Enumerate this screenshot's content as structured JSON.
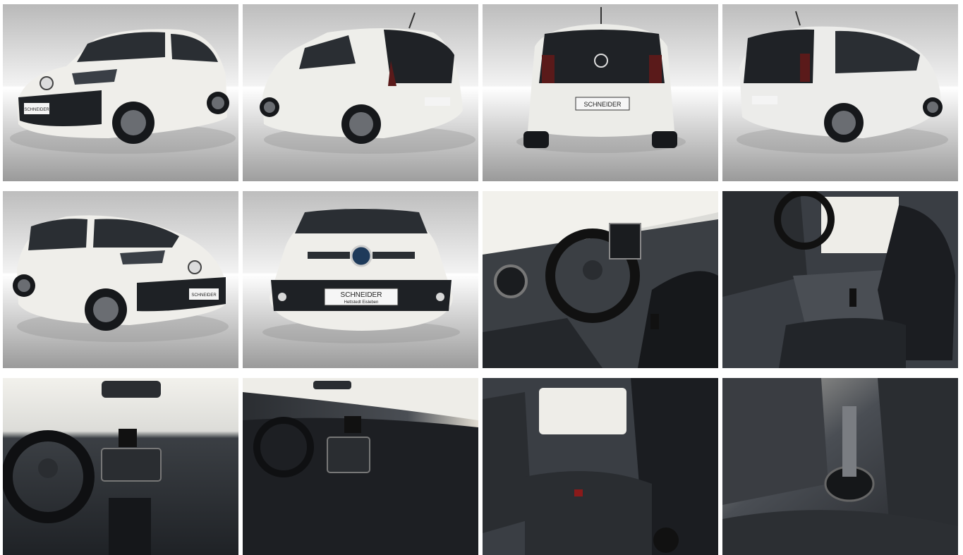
{
  "gallery": {
    "photos": [
      {
        "view": "front-left-exterior",
        "plate_text": "SCHNEIDER",
        "plate_subtext": ""
      },
      {
        "view": "rear-left-exterior",
        "plate_text": "",
        "plate_subtext": ""
      },
      {
        "view": "rear-exterior",
        "plate_text": "SCHNEIDER",
        "plate_subtext": ""
      },
      {
        "view": "rear-right-exterior",
        "plate_text": "",
        "plate_subtext": ""
      },
      {
        "view": "front-right-exterior",
        "plate_text": "SCHNEIDER",
        "plate_subtext": ""
      },
      {
        "view": "front-exterior",
        "plate_text": "SCHNEIDER",
        "plate_subtext": "Hettstedt  Eisleben"
      },
      {
        "view": "dashboard-steering-wheel",
        "plate_text": "",
        "plate_subtext": ""
      },
      {
        "view": "driver-seat-door",
        "plate_text": "",
        "plate_subtext": ""
      },
      {
        "view": "dashboard-center",
        "plate_text": "",
        "plate_subtext": ""
      },
      {
        "view": "dashboard-side",
        "plate_text": "",
        "plate_subtext": ""
      },
      {
        "view": "rear-seats",
        "plate_text": "",
        "plate_subtext": ""
      },
      {
        "view": "center-console-cupholder",
        "plate_text": "",
        "plate_subtext": ""
      }
    ],
    "colors": {
      "car_body": "#eeeeec",
      "studio_top": "#c9c9c9",
      "studio_floor": "#b5b5b5",
      "interior_dark": "#1f2226",
      "window_light": "#f2f1ec"
    }
  }
}
